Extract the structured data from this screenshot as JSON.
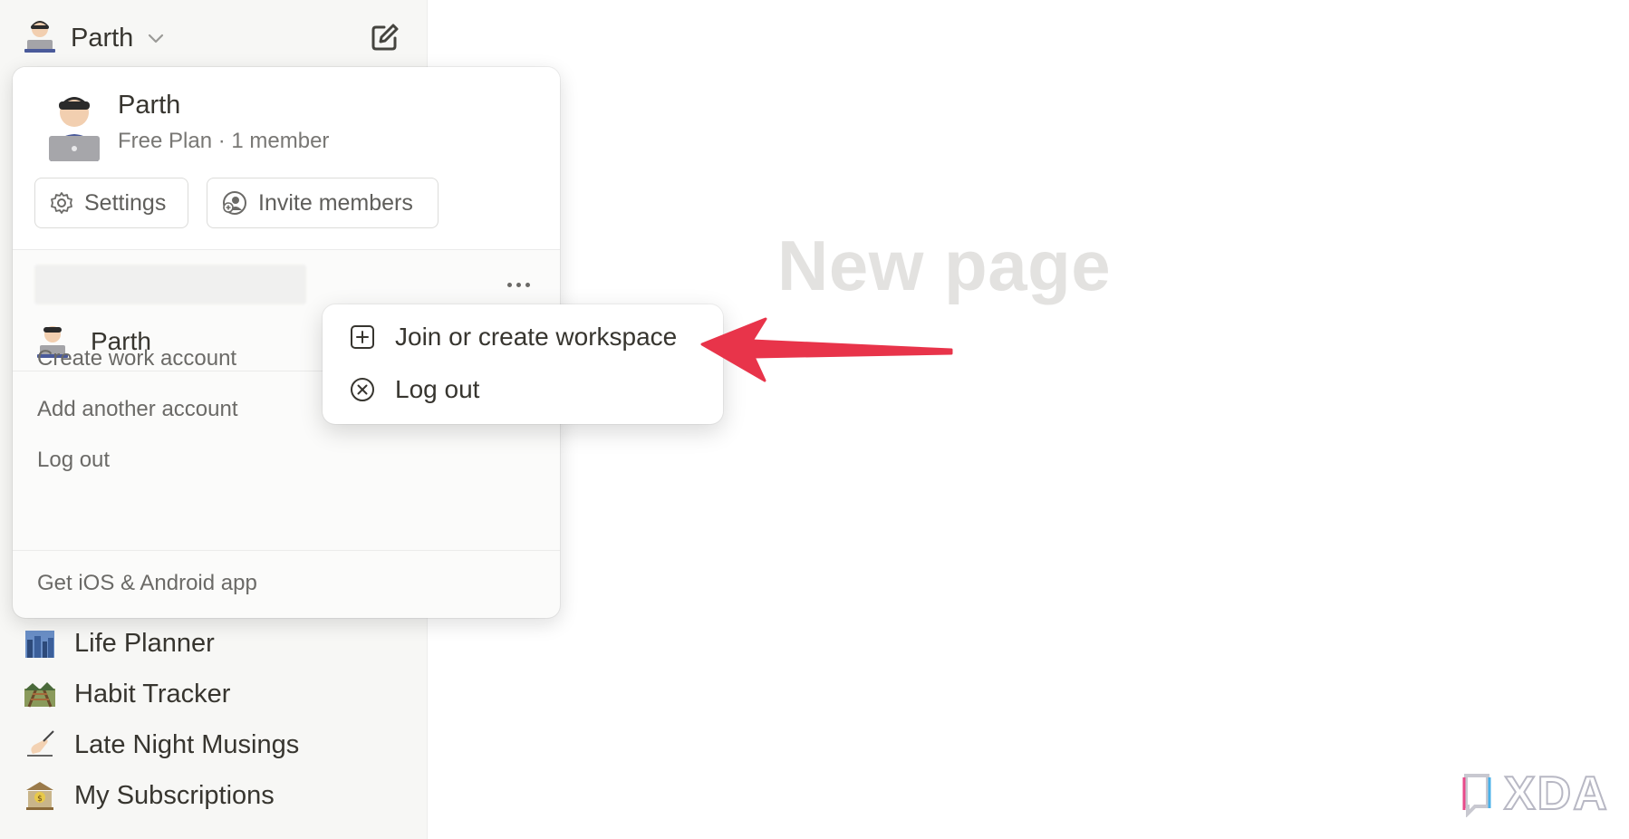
{
  "sidebar": {
    "workspace_name": "Parth",
    "pages": [
      {
        "label": "Life Planner",
        "icon": "cityscape-icon"
      },
      {
        "label": "Habit Tracker",
        "icon": "railway-track-icon"
      },
      {
        "label": "Late Night Musings",
        "icon": "writing-hand-icon"
      },
      {
        "label": "My Subscriptions",
        "icon": "bank-icon"
      }
    ]
  },
  "workspace_menu": {
    "name": "Parth",
    "subtitle": "Free Plan · 1 member",
    "settings_label": "Settings",
    "invite_label": "Invite members",
    "account_name": "Parth",
    "links": {
      "create_work": "Create work account",
      "add_account": "Add another account",
      "logout": "Log out",
      "get_app": "Get iOS & Android app"
    }
  },
  "context_menu": {
    "items": [
      {
        "label": "Join or create workspace",
        "icon": "plus-square-icon"
      },
      {
        "label": "Log out",
        "icon": "close-circle-icon"
      }
    ]
  },
  "main": {
    "placeholder_title": "New page"
  },
  "watermark": {
    "brand": "XDA"
  },
  "colors": {
    "arrow": "#e8344a",
    "sidebar_bg": "#f7f7f5",
    "text": "#37352f",
    "muted": "#787774"
  }
}
